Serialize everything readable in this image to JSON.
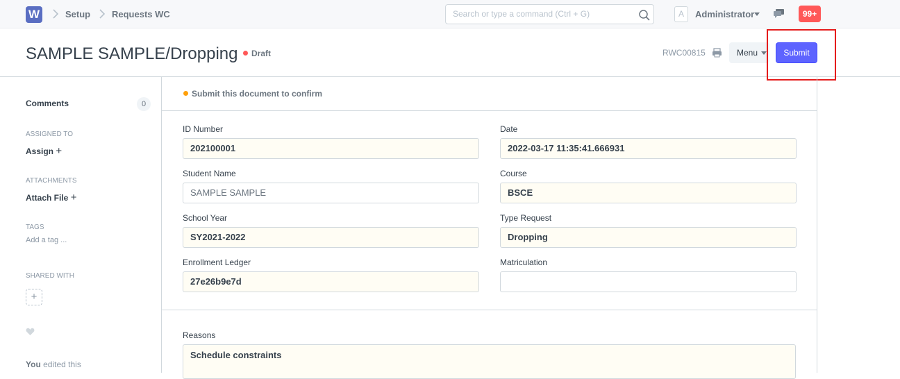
{
  "navbar": {
    "logo": "W",
    "breadcrumbs": [
      "Setup",
      "Requests WC"
    ],
    "search_placeholder": "Search or type a command (Ctrl + G)",
    "avatar_letter": "A",
    "user_name": "Administrator",
    "notification_count": "99+"
  },
  "page": {
    "title": "SAMPLE SAMPLE/Dropping",
    "status": "Draft",
    "doc_name": "RWC00815",
    "menu_label": "Menu",
    "submit_label": "Submit"
  },
  "sidebar": {
    "comments_label": "Comments",
    "comments_count": "0",
    "assigned_to_label": "ASSIGNED TO",
    "assign_label": "Assign",
    "attachments_label": "ATTACHMENTS",
    "attach_label": "Attach File",
    "tags_label": "TAGS",
    "add_tag": "Add a tag ...",
    "shared_with_label": "SHARED WITH",
    "activity_user": "You",
    "activity_text": "edited this"
  },
  "form": {
    "message": "Submit this document to confirm",
    "fields": {
      "id_number": {
        "label": "ID Number",
        "value": "202100001"
      },
      "date": {
        "label": "Date",
        "value": "2022-03-17 11:35:41.666931"
      },
      "student_name": {
        "label": "Student Name",
        "value": "SAMPLE SAMPLE"
      },
      "course": {
        "label": "Course",
        "value": "BSCE"
      },
      "school_year": {
        "label": "School Year",
        "value": "SY2021-2022"
      },
      "type_request": {
        "label": "Type Request",
        "value": "Dropping"
      },
      "enrollment_ledger": {
        "label": "Enrollment Ledger",
        "value": "27e26b9e7d"
      },
      "matriculation": {
        "label": "Matriculation",
        "value": ""
      },
      "reasons": {
        "label": "Reasons",
        "value": "Schedule constraints"
      }
    }
  },
  "colors": {
    "primary": "#5e64ff",
    "draft_indicator": "#ff5858",
    "warning_indicator": "#ffa00a",
    "highlight_box": "#e51c1c"
  }
}
